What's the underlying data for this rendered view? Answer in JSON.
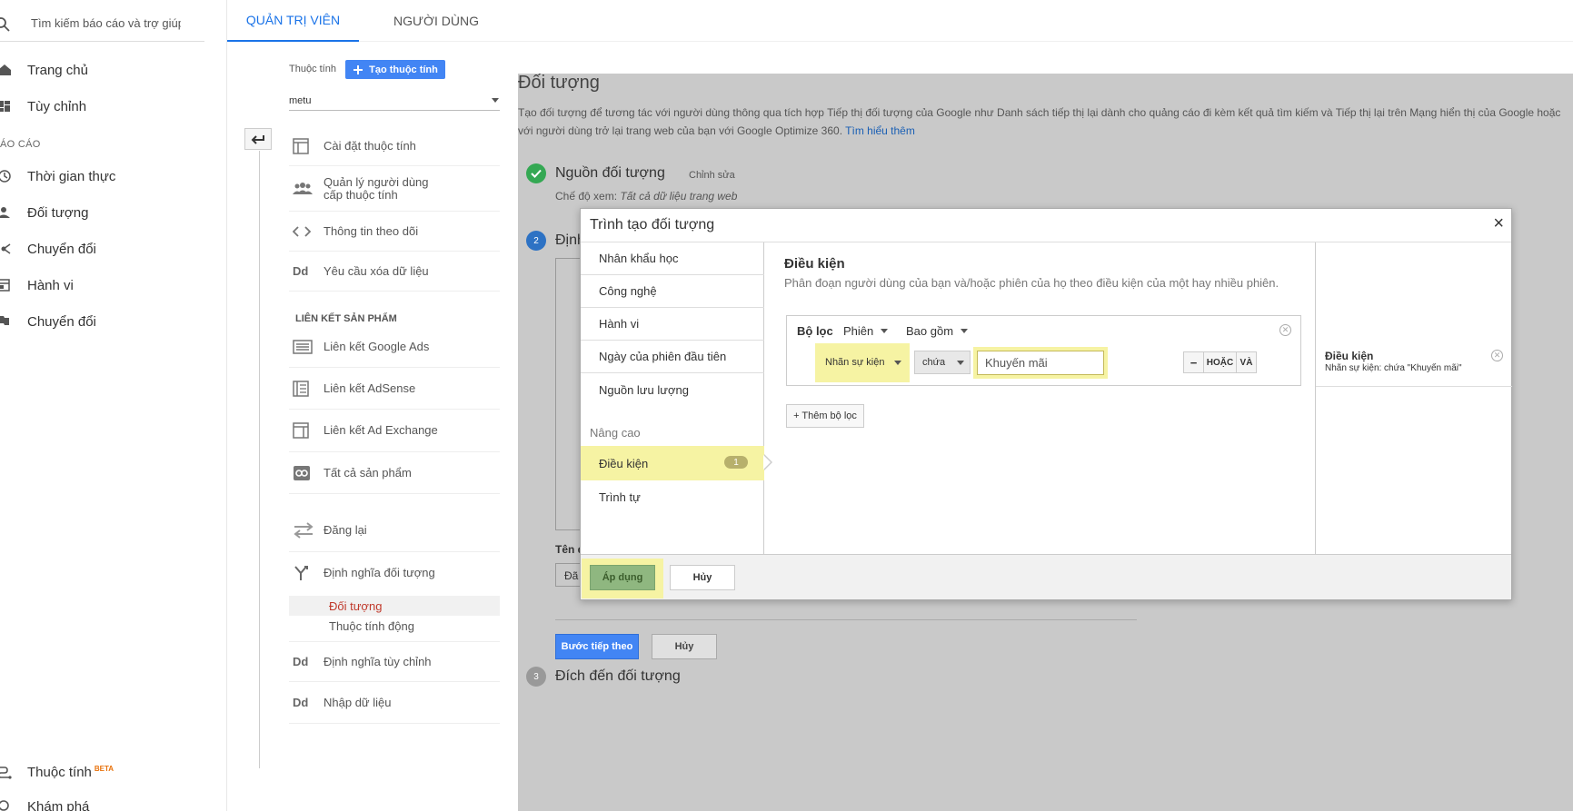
{
  "search": {
    "placeholder": "Tìm kiếm báo cáo và trợ giúp"
  },
  "leftnav": {
    "items_top": [
      {
        "label": "Trang chủ",
        "icon": "home-icon"
      },
      {
        "label": "Tùy chỉnh",
        "icon": "dashboard-icon"
      }
    ],
    "section_label": "ÁO CÁO",
    "items_reports": [
      {
        "label": "Thời gian thực",
        "icon": "clock-icon"
      },
      {
        "label": "Đối tượng",
        "icon": "person-icon"
      },
      {
        "label": "Chuyển đổi",
        "icon": "acquisition-icon"
      },
      {
        "label": "Hành vi",
        "icon": "behavior-icon"
      },
      {
        "label": "Chuyển đổi",
        "icon": "flag-icon"
      }
    ],
    "items_bottom": [
      {
        "label": "Thuộc tính",
        "badge": "BETA",
        "icon": "attribution-icon"
      },
      {
        "label": "Khám phá",
        "icon": "discover-icon"
      }
    ]
  },
  "tabs": {
    "admin": "QUẢN TRỊ VIÊN",
    "user": "NGƯỜI DÙNG"
  },
  "property": {
    "label": "Thuộc tính",
    "create_button": "Tạo thuộc tính",
    "selected": "metu",
    "items": [
      {
        "label": "Cài đặt thuộc tính",
        "icon": "settings-window-icon"
      },
      {
        "label": "Quản lý người dùng cấp thuộc tính",
        "icon": "users-icon"
      },
      {
        "label": "Thông tin theo dõi",
        "icon": "code-icon"
      },
      {
        "label": "Yêu cầu xóa dữ liệu",
        "icon": "dd-icon",
        "glyph": "Dd"
      }
    ],
    "section_links": "LIÊN KẾT SẢN PHẨM",
    "links": [
      {
        "label": "Liên kết Google Ads",
        "icon": "ads-icon"
      },
      {
        "label": "Liên kết AdSense",
        "icon": "adsense-icon"
      },
      {
        "label": "Liên kết Ad Exchange",
        "icon": "adexchange-icon"
      },
      {
        "label": "Tất cả sản phẩm",
        "icon": "link-icon"
      }
    ],
    "items2": [
      {
        "label": "Đăng lại",
        "icon": "postback-icon"
      },
      {
        "label": "Định nghĩa đối tượng",
        "icon": "fork-icon"
      }
    ],
    "sub_items": [
      {
        "label": "Đối tượng",
        "active": true
      },
      {
        "label": "Thuộc tính động",
        "active": false
      }
    ],
    "items3": [
      {
        "label": "Định nghĩa tùy chỉnh",
        "icon": "dd-icon",
        "glyph": "Dd"
      },
      {
        "label": "Nhập dữ liệu",
        "icon": "dd-icon",
        "glyph": "Dd"
      }
    ]
  },
  "main": {
    "title": "Đối tượng",
    "description": "Tạo đối tượng để tương tác với người dùng thông qua tích hợp Tiếp thị đối tượng của Google như Danh sách tiếp thị lại dành cho quảng cáo đi kèm kết quả tìm kiếm và Tiếp thị lại trên Mạng hiển thị của Google hoặc với người dùng trở lại trang web của bạn với Google Optimize 360.",
    "learn_more": "Tìm hiểu thêm",
    "step1": {
      "title": "Nguồn đối tượng",
      "edit": "Chỉnh sửa",
      "view_label": "Chế độ xem:",
      "view_value": "Tất cả dữ liệu trang web"
    },
    "step2": {
      "number": "2",
      "title_partial": "Định",
      "name_label_partial": "Tên đ",
      "name_value_partial": "Đã"
    },
    "next_button": "Bước tiếp theo",
    "cancel_button": "Hủy",
    "step3": {
      "number": "3",
      "title": "Đích đến đối tượng"
    }
  },
  "modal": {
    "title": "Trình tạo đối tượng",
    "close": "×",
    "nav": [
      "Nhân khẩu học",
      "Công nghệ",
      "Hành vi",
      "Ngày của phiên đầu tiên",
      "Nguồn lưu lượng"
    ],
    "advanced_label": "Nâng cao",
    "nav_adv": [
      {
        "label": "Điều kiện",
        "badge": "1"
      },
      {
        "label": "Trình tự"
      }
    ],
    "content": {
      "title": "Điều kiện",
      "description": "Phân đoạn người dùng của bạn và/hoặc phiên của họ theo điều kiện của một hay nhiều phiên.",
      "filter_label": "Bộ lọc",
      "scope": "Phiên",
      "include": "Bao gồm",
      "dimension": "Nhãn sự kiện",
      "operator": "chứa",
      "value": "Khuyến mãi",
      "btn_minus": "−",
      "btn_or": "HOẶC",
      "btn_and": "VÀ",
      "add_filter": "+ Thêm bộ lọc"
    },
    "summary": {
      "title": "Điều kiện",
      "detail": "Nhãn sự kiện: chứa \"Khuyến mãi\""
    },
    "apply_button": "Áp dụng",
    "cancel_button": "Hủy"
  },
  "colors": {
    "accent_blue": "#4285f4",
    "tab_active": "#1a73e8",
    "highlight_yellow": "#f6f3a3",
    "apply_green": "#8fb780",
    "overlay_gray": "#c9c9c9",
    "check_green": "#34a853",
    "active_sub_red": "#c0392b"
  }
}
